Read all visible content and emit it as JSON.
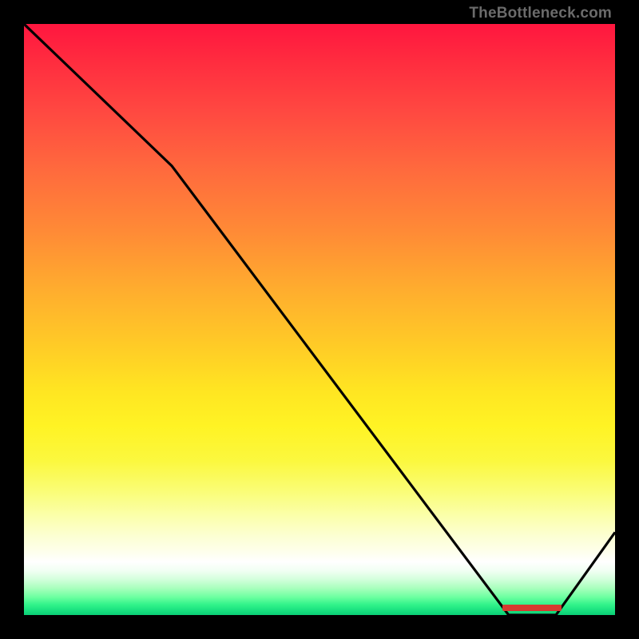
{
  "attribution": "TheBottleneck.com",
  "colors": {
    "frame": "#000000",
    "curve": "#000000",
    "marker": "#d63a2f"
  },
  "chart_data": {
    "type": "line",
    "title": "",
    "xlabel": "",
    "ylabel": "",
    "xlim": [
      0,
      100
    ],
    "ylim": [
      0,
      100
    ],
    "grid": false,
    "legend": false,
    "background": "heatmap-gradient vertical red→yellow→white→green",
    "series": [
      {
        "name": "bottleneck-curve",
        "x": [
          0,
          25,
          82,
          90,
          100
        ],
        "y": [
          100,
          76,
          0,
          0,
          14
        ]
      }
    ],
    "annotations": [
      {
        "name": "optimal-zone-marker",
        "type": "segment",
        "x0": 81,
        "x1": 91,
        "y": 1.2
      }
    ]
  }
}
